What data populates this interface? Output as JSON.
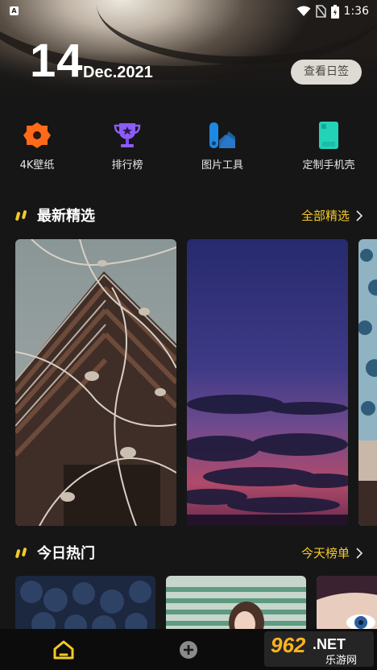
{
  "status_bar": {
    "time": "1:36",
    "app_icon_letter": "A"
  },
  "header": {
    "day": "14",
    "month_year": "Dec.2021",
    "daily_button": "查看日签"
  },
  "quick_nav": [
    {
      "label": "4K壁纸",
      "icon": "hexagon-flower-icon",
      "color": "#ff6a1a"
    },
    {
      "label": "排行榜",
      "icon": "trophy-icon",
      "color": "#8b5cf6"
    },
    {
      "label": "图片工具",
      "icon": "image-tool-icon",
      "color": "#1e88e5"
    },
    {
      "label": "定制手机壳",
      "icon": "phone-case-icon",
      "color": "#22d3b8"
    }
  ],
  "latest": {
    "title": "最新精选",
    "more": "全部精选"
  },
  "hot": {
    "title": "今日热门",
    "more": "今天榜单"
  },
  "watermark": {
    "brand": "962",
    "tld": ".NET",
    "sub": "乐游网"
  },
  "colors": {
    "accent": "#f3c928",
    "background": "#161616",
    "nav_active": "#f3c928"
  }
}
